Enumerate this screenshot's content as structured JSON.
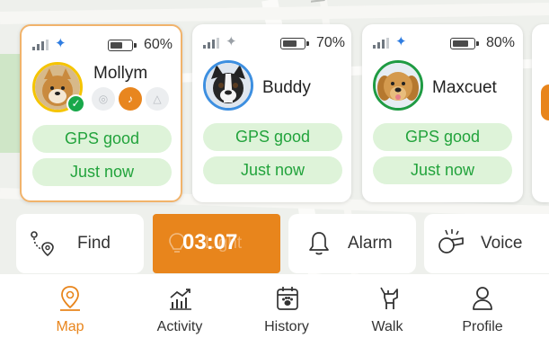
{
  "map": {
    "street_label": "We"
  },
  "colors": {
    "accent": "#e8851c",
    "pill_bg": "#def3d9",
    "pill_text": "#22a33c",
    "bluetooth_on": "#2f7de1",
    "online_check": "#18a84a"
  },
  "pets": [
    {
      "name": "Mollym",
      "battery_label": "60%",
      "battery_level": 0.6,
      "bluetooth": "connected",
      "gps_status": "GPS good",
      "last_seen": "Just now",
      "selected": true,
      "avatar_icon": "shiba-inu-avatar",
      "mini_icons": [
        "location-pin-icon",
        "bell-ring-icon",
        "bell-icon"
      ]
    },
    {
      "name": "Buddy",
      "battery_label": "70%",
      "battery_level": 0.7,
      "bluetooth": "disconnected",
      "gps_status": "GPS good",
      "last_seen": "Just now",
      "selected": false,
      "avatar_icon": "boston-terrier-avatar"
    },
    {
      "name": "Maxcuet",
      "battery_label": "80%",
      "battery_level": 0.8,
      "bluetooth": "connected",
      "gps_status": "GPS good",
      "last_seen": "Just now",
      "selected": false,
      "avatar_icon": "golden-retriever-avatar"
    }
  ],
  "actions": {
    "find": {
      "label": "Find",
      "icon": "route-pin-icon"
    },
    "light": {
      "label": "Light",
      "timer": "03:07",
      "icon": "light-bulb-icon"
    },
    "alarm": {
      "label": "Alarm",
      "icon": "bell-icon"
    },
    "voice": {
      "label": "Voice",
      "icon": "whistle-icon"
    }
  },
  "nav": [
    {
      "label": "Map",
      "icon": "map-pin-icon",
      "active": true
    },
    {
      "label": "Activity",
      "icon": "activity-chart-icon",
      "active": false
    },
    {
      "label": "History",
      "icon": "calendar-paw-icon",
      "active": false
    },
    {
      "label": "Walk",
      "icon": "dog-walk-icon",
      "active": false
    },
    {
      "label": "Profile",
      "icon": "person-icon",
      "active": false
    }
  ]
}
